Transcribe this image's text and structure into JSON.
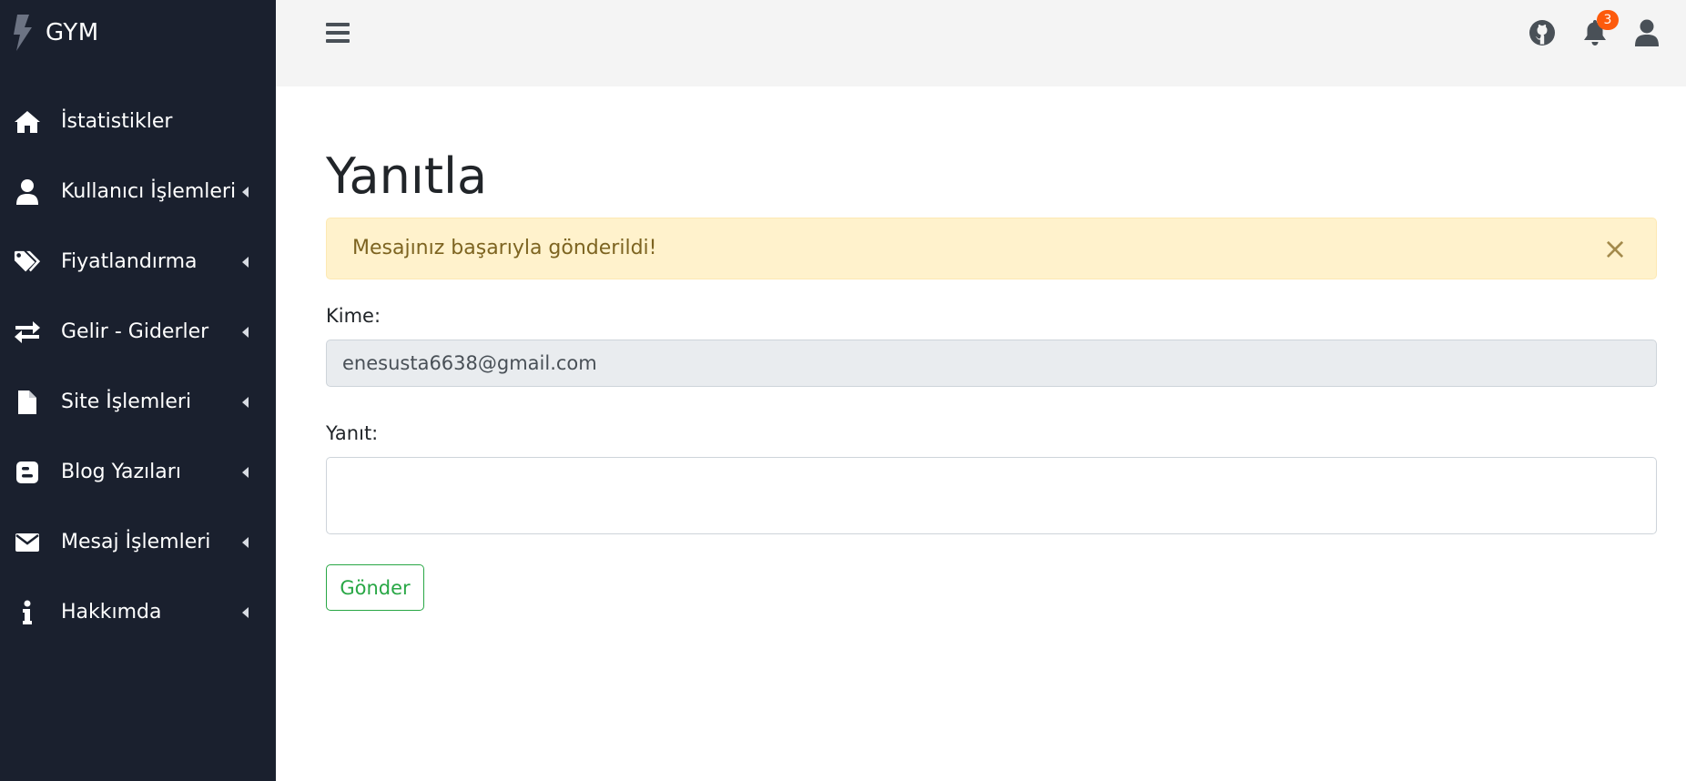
{
  "brand": {
    "name": "GYM",
    "logo_icon": "bolt-icon"
  },
  "sidebar": {
    "items": [
      {
        "label": "İstatistikler",
        "icon": "home-icon",
        "has_submenu": false
      },
      {
        "label": "Kullanıcı İşlemleri",
        "icon": "user-icon",
        "has_submenu": true
      },
      {
        "label": "Fiyatlandırma",
        "icon": "tags-icon",
        "has_submenu": true
      },
      {
        "label": "Gelir - Giderler",
        "icon": "exchange-icon",
        "has_submenu": true
      },
      {
        "label": "Site İşlemleri",
        "icon": "file-icon",
        "has_submenu": true
      },
      {
        "label": "Blog Yazıları",
        "icon": "blogger-icon",
        "has_submenu": true
      },
      {
        "label": "Mesaj İşlemleri",
        "icon": "envelope-icon",
        "has_submenu": true
      },
      {
        "label": "Hakkımda",
        "icon": "info-icon",
        "has_submenu": true
      }
    ]
  },
  "topbar": {
    "menu_icon": "hamburger-icon",
    "github_icon": "github-icon",
    "notifications_icon": "bell-icon",
    "notification_count": "3",
    "user_icon": "user-icon"
  },
  "main": {
    "title": "Yanıtla",
    "alert": {
      "message": "Mesajınız başarıyla gönderildi!",
      "close": "×"
    },
    "to_label": "Kime:",
    "to_value": "enesusta6638@gmail.com",
    "reply_label": "Yanıt:",
    "reply_value": "",
    "submit_label": "Gönder"
  },
  "colors": {
    "sidebar_bg": "#1a202e",
    "topbar_bg": "#f4f4f4",
    "alert_bg": "#fff2cc",
    "alert_text": "#7d6421",
    "badge": "#fd5a0c",
    "success": "#28a745"
  }
}
